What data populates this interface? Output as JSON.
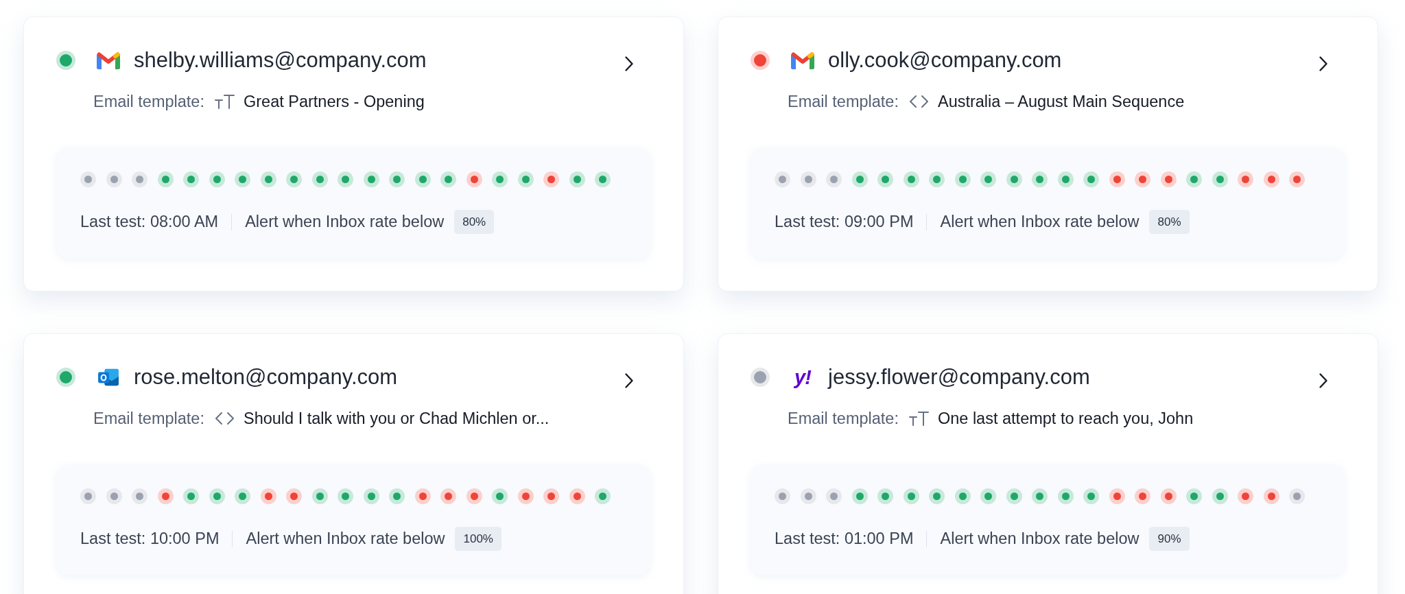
{
  "accounts": [
    {
      "status": {
        "color": "#1ea86a"
      },
      "logo": {
        "kind": "gmail"
      },
      "email": "shelby.williams@company.com",
      "template": {
        "label": "Email template:",
        "kind": "text",
        "name": "Great Partners - Opening"
      },
      "tests": [
        {
          "color": "#9ba1af"
        },
        {
          "color": "#9ba1af"
        },
        {
          "color": "#9ba1af"
        },
        {
          "color": "#1ea86a"
        },
        {
          "color": "#1ea86a"
        },
        {
          "color": "#1ea86a"
        },
        {
          "color": "#1ea86a"
        },
        {
          "color": "#1ea86a"
        },
        {
          "color": "#1ea86a"
        },
        {
          "color": "#1ea86a"
        },
        {
          "color": "#1ea86a"
        },
        {
          "color": "#1ea86a"
        },
        {
          "color": "#1ea86a"
        },
        {
          "color": "#1ea86a"
        },
        {
          "color": "#1ea86a"
        },
        {
          "color": "#f04438"
        },
        {
          "color": "#1ea86a"
        },
        {
          "color": "#1ea86a"
        },
        {
          "color": "#f04438"
        },
        {
          "color": "#1ea86a"
        },
        {
          "color": "#1ea86a"
        }
      ],
      "last_test": "Last test: 08:00 AM",
      "alert": {
        "label": "Alert when Inbox rate below",
        "threshold": "80%"
      }
    },
    {
      "status": {
        "color": "#f04438"
      },
      "logo": {
        "kind": "gmail"
      },
      "email": "olly.cook@company.com",
      "template": {
        "label": "Email template:",
        "kind": "code",
        "name": "Australia – August Main Sequence"
      },
      "tests": [
        {
          "color": "#9ba1af"
        },
        {
          "color": "#9ba1af"
        },
        {
          "color": "#9ba1af"
        },
        {
          "color": "#1ea86a"
        },
        {
          "color": "#1ea86a"
        },
        {
          "color": "#1ea86a"
        },
        {
          "color": "#1ea86a"
        },
        {
          "color": "#1ea86a"
        },
        {
          "color": "#1ea86a"
        },
        {
          "color": "#1ea86a"
        },
        {
          "color": "#1ea86a"
        },
        {
          "color": "#1ea86a"
        },
        {
          "color": "#1ea86a"
        },
        {
          "color": "#f04438"
        },
        {
          "color": "#f04438"
        },
        {
          "color": "#f04438"
        },
        {
          "color": "#1ea86a"
        },
        {
          "color": "#1ea86a"
        },
        {
          "color": "#f04438"
        },
        {
          "color": "#f04438"
        },
        {
          "color": "#f04438"
        }
      ],
      "last_test": "Last test: 09:00 PM",
      "alert": {
        "label": "Alert when Inbox rate below",
        "threshold": "80%"
      }
    },
    {
      "status": {
        "color": "#1ea86a"
      },
      "logo": {
        "kind": "outlook"
      },
      "email": "rose.melton@company.com",
      "template": {
        "label": "Email template:",
        "kind": "code",
        "name": "Should I talk with you or Chad Michlen or..."
      },
      "tests": [
        {
          "color": "#9ba1af"
        },
        {
          "color": "#9ba1af"
        },
        {
          "color": "#9ba1af"
        },
        {
          "color": "#f04438"
        },
        {
          "color": "#1ea86a"
        },
        {
          "color": "#1ea86a"
        },
        {
          "color": "#1ea86a"
        },
        {
          "color": "#f04438"
        },
        {
          "color": "#f04438"
        },
        {
          "color": "#1ea86a"
        },
        {
          "color": "#1ea86a"
        },
        {
          "color": "#1ea86a"
        },
        {
          "color": "#1ea86a"
        },
        {
          "color": "#f04438"
        },
        {
          "color": "#f04438"
        },
        {
          "color": "#f04438"
        },
        {
          "color": "#1ea86a"
        },
        {
          "color": "#f04438"
        },
        {
          "color": "#f04438"
        },
        {
          "color": "#f04438"
        },
        {
          "color": "#1ea86a"
        }
      ],
      "last_test": "Last test: 10:00 PM",
      "alert": {
        "label": "Alert when Inbox rate below",
        "threshold": "100%"
      }
    },
    {
      "status": {
        "color": "#9ba1af"
      },
      "logo": {
        "kind": "yahoo",
        "text": "y!"
      },
      "email": "jessy.flower@company.com",
      "template": {
        "label": "Email template:",
        "kind": "text",
        "name": "One last attempt to reach you, John"
      },
      "tests": [
        {
          "color": "#9ba1af"
        },
        {
          "color": "#9ba1af"
        },
        {
          "color": "#9ba1af"
        },
        {
          "color": "#1ea86a"
        },
        {
          "color": "#1ea86a"
        },
        {
          "color": "#1ea86a"
        },
        {
          "color": "#1ea86a"
        },
        {
          "color": "#1ea86a"
        },
        {
          "color": "#1ea86a"
        },
        {
          "color": "#1ea86a"
        },
        {
          "color": "#1ea86a"
        },
        {
          "color": "#1ea86a"
        },
        {
          "color": "#1ea86a"
        },
        {
          "color": "#f04438"
        },
        {
          "color": "#f04438"
        },
        {
          "color": "#f04438"
        },
        {
          "color": "#1ea86a"
        },
        {
          "color": "#1ea86a"
        },
        {
          "color": "#f04438"
        },
        {
          "color": "#f04438"
        },
        {
          "color": "#9ba1af"
        }
      ],
      "last_test": "Last test: 01:00 PM",
      "alert": {
        "label": "Alert when Inbox rate below",
        "threshold": "90%"
      }
    }
  ]
}
